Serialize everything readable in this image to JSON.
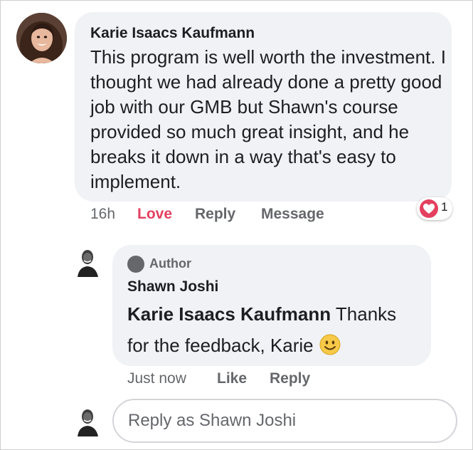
{
  "comment": {
    "author": "Karie Isaacs Kaufmann",
    "text": "This program is well worth the investment. I thought we had already done a pretty good job with our GMB but Shawn's course provided so much great insight, and he breaks it down in a way that's easy to implement.",
    "time": "16h",
    "actions": {
      "love": "Love",
      "reply": "Reply",
      "message": "Message"
    },
    "reaction": {
      "icon": "heart-icon",
      "count": "1",
      "color": "#e4405f"
    }
  },
  "reply": {
    "badge": "Author",
    "author": "Shawn Joshi",
    "mention": "Karie Isaacs Kaufmann",
    "text": " Thanks for the feedback, Karie",
    "emoji": "smiley-emoji-icon",
    "time": "Just now",
    "actions": {
      "like": "Like",
      "reply": "Reply"
    }
  },
  "composer": {
    "placeholder": "Reply as Shawn Joshi"
  },
  "colors": {
    "bubble": "#f0f2f5",
    "meta_text": "#65676b",
    "love": "#e4405f"
  }
}
